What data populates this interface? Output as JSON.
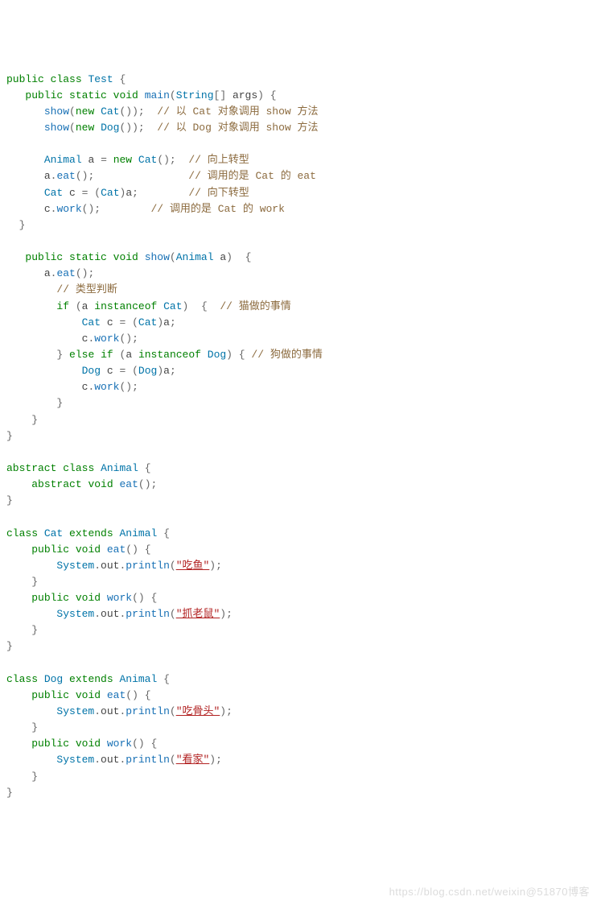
{
  "code": {
    "tokens": [
      {
        "t": "kw",
        "v": "public"
      },
      {
        "t": "sp",
        "v": " "
      },
      {
        "t": "kw",
        "v": "class"
      },
      {
        "t": "sp",
        "v": " "
      },
      {
        "t": "type",
        "v": "Test"
      },
      {
        "t": "sp",
        "v": " "
      },
      {
        "t": "punc",
        "v": "{"
      },
      {
        "t": "nl"
      },
      {
        "t": "sp",
        "v": "   "
      },
      {
        "t": "kw",
        "v": "public"
      },
      {
        "t": "sp",
        "v": " "
      },
      {
        "t": "kw",
        "v": "static"
      },
      {
        "t": "sp",
        "v": " "
      },
      {
        "t": "kw",
        "v": "void"
      },
      {
        "t": "sp",
        "v": " "
      },
      {
        "t": "call",
        "v": "main"
      },
      {
        "t": "punc",
        "v": "("
      },
      {
        "t": "type",
        "v": "String"
      },
      {
        "t": "punc",
        "v": "[]"
      },
      {
        "t": "sp",
        "v": " "
      },
      {
        "t": "black",
        "v": "args"
      },
      {
        "t": "punc",
        "v": ")"
      },
      {
        "t": "sp",
        "v": " "
      },
      {
        "t": "punc",
        "v": "{"
      },
      {
        "t": "nl"
      },
      {
        "t": "sp",
        "v": "      "
      },
      {
        "t": "call",
        "v": "show"
      },
      {
        "t": "punc",
        "v": "("
      },
      {
        "t": "kw",
        "v": "new"
      },
      {
        "t": "sp",
        "v": " "
      },
      {
        "t": "type",
        "v": "Cat"
      },
      {
        "t": "punc",
        "v": "());"
      },
      {
        "t": "sp",
        "v": "  "
      },
      {
        "t": "comment",
        "v": "// 以 Cat 对象调用 show 方法"
      },
      {
        "t": "nl"
      },
      {
        "t": "sp",
        "v": "      "
      },
      {
        "t": "call",
        "v": "show"
      },
      {
        "t": "punc",
        "v": "("
      },
      {
        "t": "kw",
        "v": "new"
      },
      {
        "t": "sp",
        "v": " "
      },
      {
        "t": "type",
        "v": "Dog"
      },
      {
        "t": "punc",
        "v": "());"
      },
      {
        "t": "sp",
        "v": "  "
      },
      {
        "t": "comment",
        "v": "// 以 Dog 对象调用 show 方法"
      },
      {
        "t": "nl"
      },
      {
        "t": "nl"
      },
      {
        "t": "sp",
        "v": "      "
      },
      {
        "t": "type",
        "v": "Animal"
      },
      {
        "t": "sp",
        "v": " "
      },
      {
        "t": "black",
        "v": "a"
      },
      {
        "t": "sp",
        "v": " "
      },
      {
        "t": "punc",
        "v": "="
      },
      {
        "t": "sp",
        "v": " "
      },
      {
        "t": "kw",
        "v": "new"
      },
      {
        "t": "sp",
        "v": " "
      },
      {
        "t": "type",
        "v": "Cat"
      },
      {
        "t": "punc",
        "v": "();"
      },
      {
        "t": "sp",
        "v": "  "
      },
      {
        "t": "comment",
        "v": "// 向上转型"
      },
      {
        "t": "nl"
      },
      {
        "t": "sp",
        "v": "      "
      },
      {
        "t": "black",
        "v": "a"
      },
      {
        "t": "punc",
        "v": "."
      },
      {
        "t": "call",
        "v": "eat"
      },
      {
        "t": "punc",
        "v": "();"
      },
      {
        "t": "sp",
        "v": "               "
      },
      {
        "t": "comment",
        "v": "// 调用的是 Cat 的 eat"
      },
      {
        "t": "nl"
      },
      {
        "t": "sp",
        "v": "      "
      },
      {
        "t": "type",
        "v": "Cat"
      },
      {
        "t": "sp",
        "v": " "
      },
      {
        "t": "black",
        "v": "c"
      },
      {
        "t": "sp",
        "v": " "
      },
      {
        "t": "punc",
        "v": "="
      },
      {
        "t": "sp",
        "v": " "
      },
      {
        "t": "punc",
        "v": "("
      },
      {
        "t": "type",
        "v": "Cat"
      },
      {
        "t": "punc",
        "v": ")"
      },
      {
        "t": "black",
        "v": "a"
      },
      {
        "t": "punc",
        "v": ";"
      },
      {
        "t": "sp",
        "v": "        "
      },
      {
        "t": "comment",
        "v": "// 向下转型"
      },
      {
        "t": "nl"
      },
      {
        "t": "sp",
        "v": "      "
      },
      {
        "t": "black",
        "v": "c"
      },
      {
        "t": "punc",
        "v": "."
      },
      {
        "t": "call",
        "v": "work"
      },
      {
        "t": "punc",
        "v": "();"
      },
      {
        "t": "sp",
        "v": "        "
      },
      {
        "t": "comment",
        "v": "// 调用的是 Cat 的 work"
      },
      {
        "t": "nl"
      },
      {
        "t": "sp",
        "v": "  "
      },
      {
        "t": "punc",
        "v": "}"
      },
      {
        "t": "nl"
      },
      {
        "t": "nl"
      },
      {
        "t": "sp",
        "v": "   "
      },
      {
        "t": "kw",
        "v": "public"
      },
      {
        "t": "sp",
        "v": " "
      },
      {
        "t": "kw",
        "v": "static"
      },
      {
        "t": "sp",
        "v": " "
      },
      {
        "t": "kw",
        "v": "void"
      },
      {
        "t": "sp",
        "v": " "
      },
      {
        "t": "call",
        "v": "show"
      },
      {
        "t": "punc",
        "v": "("
      },
      {
        "t": "type",
        "v": "Animal"
      },
      {
        "t": "sp",
        "v": " "
      },
      {
        "t": "black",
        "v": "a"
      },
      {
        "t": "punc",
        "v": ")"
      },
      {
        "t": "sp",
        "v": "  "
      },
      {
        "t": "punc",
        "v": "{"
      },
      {
        "t": "nl"
      },
      {
        "t": "sp",
        "v": "      "
      },
      {
        "t": "black",
        "v": "a"
      },
      {
        "t": "punc",
        "v": "."
      },
      {
        "t": "call",
        "v": "eat"
      },
      {
        "t": "punc",
        "v": "();"
      },
      {
        "t": "nl"
      },
      {
        "t": "sp",
        "v": "        "
      },
      {
        "t": "comment",
        "v": "// 类型判断"
      },
      {
        "t": "nl"
      },
      {
        "t": "sp",
        "v": "        "
      },
      {
        "t": "kw",
        "v": "if"
      },
      {
        "t": "sp",
        "v": " "
      },
      {
        "t": "punc",
        "v": "("
      },
      {
        "t": "black",
        "v": "a"
      },
      {
        "t": "sp",
        "v": " "
      },
      {
        "t": "kw",
        "v": "instanceof"
      },
      {
        "t": "sp",
        "v": " "
      },
      {
        "t": "type",
        "v": "Cat"
      },
      {
        "t": "punc",
        "v": ")"
      },
      {
        "t": "sp",
        "v": "  "
      },
      {
        "t": "punc",
        "v": "{"
      },
      {
        "t": "sp",
        "v": "  "
      },
      {
        "t": "comment",
        "v": "// 猫做的事情"
      },
      {
        "t": "nl"
      },
      {
        "t": "sp",
        "v": "            "
      },
      {
        "t": "type",
        "v": "Cat"
      },
      {
        "t": "sp",
        "v": " "
      },
      {
        "t": "black",
        "v": "c"
      },
      {
        "t": "sp",
        "v": " "
      },
      {
        "t": "punc",
        "v": "="
      },
      {
        "t": "sp",
        "v": " "
      },
      {
        "t": "punc",
        "v": "("
      },
      {
        "t": "type",
        "v": "Cat"
      },
      {
        "t": "punc",
        "v": ")"
      },
      {
        "t": "black",
        "v": "a"
      },
      {
        "t": "punc",
        "v": ";"
      },
      {
        "t": "nl"
      },
      {
        "t": "sp",
        "v": "            "
      },
      {
        "t": "black",
        "v": "c"
      },
      {
        "t": "punc",
        "v": "."
      },
      {
        "t": "call",
        "v": "work"
      },
      {
        "t": "punc",
        "v": "();"
      },
      {
        "t": "nl"
      },
      {
        "t": "sp",
        "v": "        "
      },
      {
        "t": "punc",
        "v": "}"
      },
      {
        "t": "sp",
        "v": " "
      },
      {
        "t": "kw",
        "v": "else"
      },
      {
        "t": "sp",
        "v": " "
      },
      {
        "t": "kw",
        "v": "if"
      },
      {
        "t": "sp",
        "v": " "
      },
      {
        "t": "punc",
        "v": "("
      },
      {
        "t": "black",
        "v": "a"
      },
      {
        "t": "sp",
        "v": " "
      },
      {
        "t": "kw",
        "v": "instanceof"
      },
      {
        "t": "sp",
        "v": " "
      },
      {
        "t": "type",
        "v": "Dog"
      },
      {
        "t": "punc",
        "v": ")"
      },
      {
        "t": "sp",
        "v": " "
      },
      {
        "t": "punc",
        "v": "{"
      },
      {
        "t": "sp",
        "v": " "
      },
      {
        "t": "comment",
        "v": "// 狗做的事情"
      },
      {
        "t": "nl"
      },
      {
        "t": "sp",
        "v": "            "
      },
      {
        "t": "type",
        "v": "Dog"
      },
      {
        "t": "sp",
        "v": " "
      },
      {
        "t": "black",
        "v": "c"
      },
      {
        "t": "sp",
        "v": " "
      },
      {
        "t": "punc",
        "v": "="
      },
      {
        "t": "sp",
        "v": " "
      },
      {
        "t": "punc",
        "v": "("
      },
      {
        "t": "type",
        "v": "Dog"
      },
      {
        "t": "punc",
        "v": ")"
      },
      {
        "t": "black",
        "v": "a"
      },
      {
        "t": "punc",
        "v": ";"
      },
      {
        "t": "nl"
      },
      {
        "t": "sp",
        "v": "            "
      },
      {
        "t": "black",
        "v": "c"
      },
      {
        "t": "punc",
        "v": "."
      },
      {
        "t": "call",
        "v": "work"
      },
      {
        "t": "punc",
        "v": "();"
      },
      {
        "t": "nl"
      },
      {
        "t": "sp",
        "v": "        "
      },
      {
        "t": "punc",
        "v": "}"
      },
      {
        "t": "nl"
      },
      {
        "t": "sp",
        "v": "    "
      },
      {
        "t": "punc",
        "v": "}"
      },
      {
        "t": "nl"
      },
      {
        "t": "punc",
        "v": "}"
      },
      {
        "t": "nl"
      },
      {
        "t": "nl"
      },
      {
        "t": "kw",
        "v": "abstract"
      },
      {
        "t": "sp",
        "v": " "
      },
      {
        "t": "kw",
        "v": "class"
      },
      {
        "t": "sp",
        "v": " "
      },
      {
        "t": "type",
        "v": "Animal"
      },
      {
        "t": "sp",
        "v": " "
      },
      {
        "t": "punc",
        "v": "{"
      },
      {
        "t": "nl"
      },
      {
        "t": "sp",
        "v": "    "
      },
      {
        "t": "kw",
        "v": "abstract"
      },
      {
        "t": "sp",
        "v": " "
      },
      {
        "t": "kw",
        "v": "void"
      },
      {
        "t": "sp",
        "v": " "
      },
      {
        "t": "call",
        "v": "eat"
      },
      {
        "t": "punc",
        "v": "();"
      },
      {
        "t": "nl"
      },
      {
        "t": "punc",
        "v": "}"
      },
      {
        "t": "nl"
      },
      {
        "t": "nl"
      },
      {
        "t": "kw",
        "v": "class"
      },
      {
        "t": "sp",
        "v": " "
      },
      {
        "t": "type",
        "v": "Cat"
      },
      {
        "t": "sp",
        "v": " "
      },
      {
        "t": "kw",
        "v": "extends"
      },
      {
        "t": "sp",
        "v": " "
      },
      {
        "t": "type",
        "v": "Animal"
      },
      {
        "t": "sp",
        "v": " "
      },
      {
        "t": "punc",
        "v": "{"
      },
      {
        "t": "nl"
      },
      {
        "t": "sp",
        "v": "    "
      },
      {
        "t": "kw",
        "v": "public"
      },
      {
        "t": "sp",
        "v": " "
      },
      {
        "t": "kw",
        "v": "void"
      },
      {
        "t": "sp",
        "v": " "
      },
      {
        "t": "call",
        "v": "eat"
      },
      {
        "t": "punc",
        "v": "()"
      },
      {
        "t": "sp",
        "v": " "
      },
      {
        "t": "punc",
        "v": "{"
      },
      {
        "t": "nl"
      },
      {
        "t": "sp",
        "v": "        "
      },
      {
        "t": "type",
        "v": "System"
      },
      {
        "t": "punc",
        "v": "."
      },
      {
        "t": "black",
        "v": "out"
      },
      {
        "t": "punc",
        "v": "."
      },
      {
        "t": "call",
        "v": "println"
      },
      {
        "t": "punc",
        "v": "("
      },
      {
        "t": "str",
        "v": "\"吃鱼\""
      },
      {
        "t": "punc",
        "v": ");"
      },
      {
        "t": "nl"
      },
      {
        "t": "sp",
        "v": "    "
      },
      {
        "t": "punc",
        "v": "}"
      },
      {
        "t": "nl"
      },
      {
        "t": "sp",
        "v": "    "
      },
      {
        "t": "kw",
        "v": "public"
      },
      {
        "t": "sp",
        "v": " "
      },
      {
        "t": "kw",
        "v": "void"
      },
      {
        "t": "sp",
        "v": " "
      },
      {
        "t": "call",
        "v": "work"
      },
      {
        "t": "punc",
        "v": "()"
      },
      {
        "t": "sp",
        "v": " "
      },
      {
        "t": "punc",
        "v": "{"
      },
      {
        "t": "nl"
      },
      {
        "t": "sp",
        "v": "        "
      },
      {
        "t": "type",
        "v": "System"
      },
      {
        "t": "punc",
        "v": "."
      },
      {
        "t": "black",
        "v": "out"
      },
      {
        "t": "punc",
        "v": "."
      },
      {
        "t": "call",
        "v": "println"
      },
      {
        "t": "punc",
        "v": "("
      },
      {
        "t": "str",
        "v": "\"抓老鼠\""
      },
      {
        "t": "punc",
        "v": ");"
      },
      {
        "t": "nl"
      },
      {
        "t": "sp",
        "v": "    "
      },
      {
        "t": "punc",
        "v": "}"
      },
      {
        "t": "nl"
      },
      {
        "t": "punc",
        "v": "}"
      },
      {
        "t": "nl"
      },
      {
        "t": "nl"
      },
      {
        "t": "kw",
        "v": "class"
      },
      {
        "t": "sp",
        "v": " "
      },
      {
        "t": "type",
        "v": "Dog"
      },
      {
        "t": "sp",
        "v": " "
      },
      {
        "t": "kw",
        "v": "extends"
      },
      {
        "t": "sp",
        "v": " "
      },
      {
        "t": "type",
        "v": "Animal"
      },
      {
        "t": "sp",
        "v": " "
      },
      {
        "t": "punc",
        "v": "{"
      },
      {
        "t": "nl"
      },
      {
        "t": "sp",
        "v": "    "
      },
      {
        "t": "kw",
        "v": "public"
      },
      {
        "t": "sp",
        "v": " "
      },
      {
        "t": "kw",
        "v": "void"
      },
      {
        "t": "sp",
        "v": " "
      },
      {
        "t": "call",
        "v": "eat"
      },
      {
        "t": "punc",
        "v": "()"
      },
      {
        "t": "sp",
        "v": " "
      },
      {
        "t": "punc",
        "v": "{"
      },
      {
        "t": "nl"
      },
      {
        "t": "sp",
        "v": "        "
      },
      {
        "t": "type",
        "v": "System"
      },
      {
        "t": "punc",
        "v": "."
      },
      {
        "t": "black",
        "v": "out"
      },
      {
        "t": "punc",
        "v": "."
      },
      {
        "t": "call",
        "v": "println"
      },
      {
        "t": "punc",
        "v": "("
      },
      {
        "t": "str",
        "v": "\"吃骨头\""
      },
      {
        "t": "punc",
        "v": ");"
      },
      {
        "t": "nl"
      },
      {
        "t": "sp",
        "v": "    "
      },
      {
        "t": "punc",
        "v": "}"
      },
      {
        "t": "nl"
      },
      {
        "t": "sp",
        "v": "    "
      },
      {
        "t": "kw",
        "v": "public"
      },
      {
        "t": "sp",
        "v": " "
      },
      {
        "t": "kw",
        "v": "void"
      },
      {
        "t": "sp",
        "v": " "
      },
      {
        "t": "call",
        "v": "work"
      },
      {
        "t": "punc",
        "v": "()"
      },
      {
        "t": "sp",
        "v": " "
      },
      {
        "t": "punc",
        "v": "{"
      },
      {
        "t": "nl"
      },
      {
        "t": "sp",
        "v": "        "
      },
      {
        "t": "type",
        "v": "System"
      },
      {
        "t": "punc",
        "v": "."
      },
      {
        "t": "black",
        "v": "out"
      },
      {
        "t": "punc",
        "v": "."
      },
      {
        "t": "call",
        "v": "println"
      },
      {
        "t": "punc",
        "v": "("
      },
      {
        "t": "str",
        "v": "\"看家\""
      },
      {
        "t": "punc",
        "v": ");"
      },
      {
        "t": "nl"
      },
      {
        "t": "sp",
        "v": "    "
      },
      {
        "t": "punc",
        "v": "}"
      },
      {
        "t": "nl"
      },
      {
        "t": "punc",
        "v": "}"
      }
    ]
  },
  "watermark": "https://blog.csdn.net/weixin@51870博客"
}
